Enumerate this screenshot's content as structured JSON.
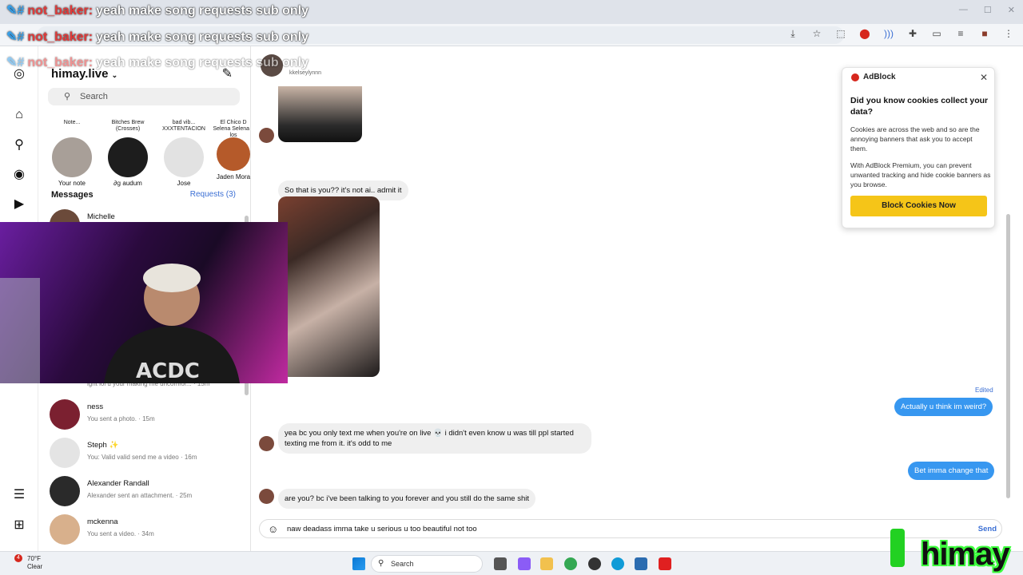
{
  "stream_chat": {
    "user": "not_baker:",
    "message": "yeah make song requests sub only"
  },
  "instagram": {
    "account": "himay.live",
    "search_placeholder": "Search",
    "notes": [
      {
        "bubble": "Note...",
        "name": "Your note"
      },
      {
        "bubble": "Bitches Brew (Crosses)",
        "name": "∂ց audum"
      },
      {
        "bubble": "bad vib... XXXTENTACION",
        "name": "Jose"
      },
      {
        "bubble": "El Chico D Selena Selena y los",
        "name": "Jaden Mora"
      }
    ],
    "messages_header": "Messages",
    "requests_label": "Requests (3)",
    "conversations": [
      {
        "name": "Michelle",
        "sub": ""
      },
      {
        "name": "",
        "sub": "ight lol u your making me uncomfor... · 15m"
      },
      {
        "name": "ness",
        "sub": "You sent a photo. · 15m"
      },
      {
        "name": "Steph ✨",
        "sub": "You: Valid valid send me a video · 16m"
      },
      {
        "name": "Alexander Randall",
        "sub": "Alexander sent an attachment. · 25m"
      },
      {
        "name": "mckenna",
        "sub": "You sent a video. · 34m"
      }
    ]
  },
  "thread": {
    "contact_name": "kkelseylynnn",
    "messages": {
      "in_1": "So that is you?? it's not ai.. admit it",
      "out_1_edited": "Edited",
      "out_1": "Actually u think im weird?",
      "in_2": "yea bc you only text me when you're on live 💀 i didn't even know u was till ppl started texting me from it. it's odd to me",
      "out_2": "Bet imma change that",
      "in_3": "are you? bc i've been talking to you forever and you still do the same shit"
    },
    "composer_text": "naw deadass imma take u serious u too beautiful not too",
    "send_label": "Send"
  },
  "adblock": {
    "title": "AdBlock",
    "heading": "Did you know cookies collect your data?",
    "para1": "Cookies are across the web and so are the annoying banners that ask you to accept them.",
    "para2": "With AdBlock Premium, you can prevent unwanted tracking and hide cookie banners as you browse.",
    "button": "Block Cookies Now"
  },
  "taskbar": {
    "temp": "70°F",
    "condition": "Clear",
    "badge": "4",
    "search": "Search"
  },
  "brand": "himay"
}
